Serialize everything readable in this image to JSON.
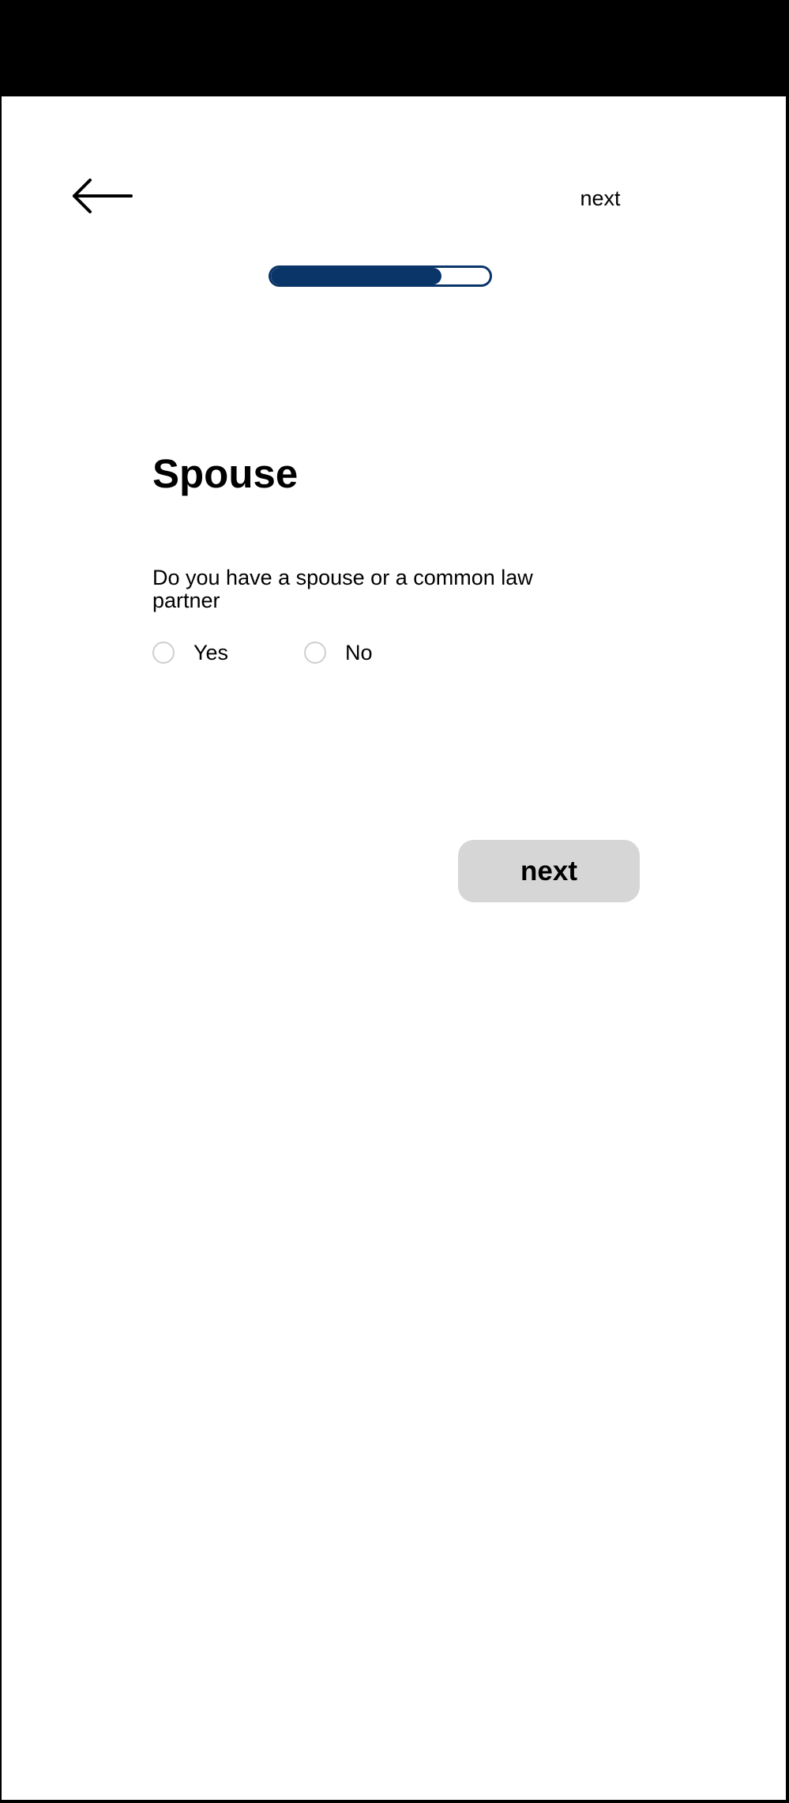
{
  "header": {
    "back_icon": "arrow-left-icon",
    "next_label": "next"
  },
  "progress": {
    "value": 0.78,
    "fill_color": "#0a3568"
  },
  "page": {
    "title": "Spouse",
    "question": "Do you have a spouse or a common law partner"
  },
  "options": {
    "yes_label": "Yes",
    "no_label": "No"
  },
  "footer": {
    "next_button_label": "next"
  },
  "colors": {
    "accent": "#0a3568",
    "button_bg": "#d6d6d6"
  }
}
